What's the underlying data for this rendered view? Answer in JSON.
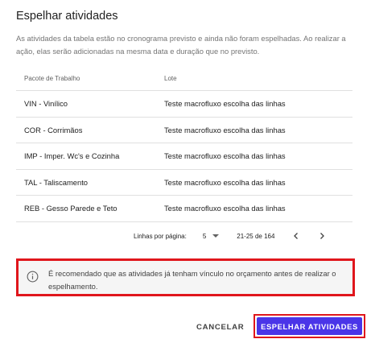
{
  "dialog": {
    "title": "Espelhar atividades",
    "description": "As atividades da tabela estão no cronograma previsto e ainda não foram espelhadas. Ao realizar a ação, elas serão adicionadas na mesma data e duração que no previsto."
  },
  "table": {
    "headers": [
      "Pacote de Trabalho",
      "Lote"
    ],
    "rows": [
      [
        "VIN - Vinílico",
        "Teste macrofluxo escolha das linhas"
      ],
      [
        "COR - Corrimãos",
        "Teste macrofluxo escolha das linhas"
      ],
      [
        "IMP - Imper. Wc's e Cozinha",
        "Teste macrofluxo escolha das linhas"
      ],
      [
        "TAL - Taliscamento",
        "Teste macrofluxo escolha das linhas"
      ],
      [
        "REB - Gesso Parede e Teto",
        "Teste macrofluxo escolha das linhas"
      ]
    ]
  },
  "pagination": {
    "rows_per_page_label": "Linhas por página:",
    "rows_per_page_value": "5",
    "range": "21-25 de 164"
  },
  "alert": {
    "icon": "info-icon",
    "text": "É recomendado que as atividades já tenham vínculo no orçamento antes de realizar o espelhamento.",
    "border_color": "#e0161c"
  },
  "actions": {
    "cancel_label": "CANCELAR",
    "confirm_label": "ESPELHAR ATIVIDADES",
    "confirm_color": "#4a35e8"
  }
}
